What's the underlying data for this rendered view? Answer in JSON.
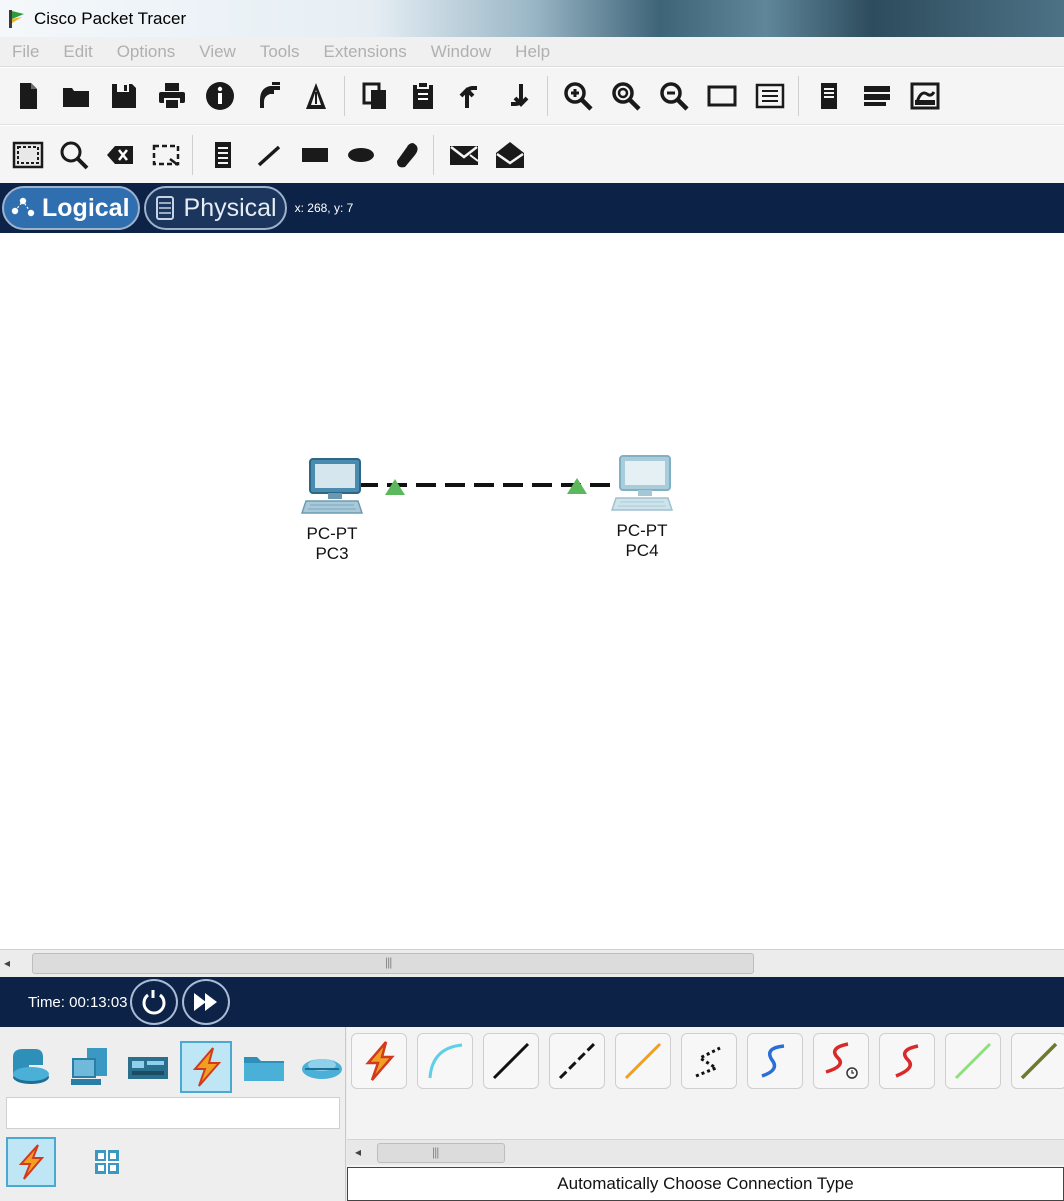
{
  "window": {
    "title": "Cisco Packet Tracer"
  },
  "menu": [
    "File",
    "Edit",
    "Options",
    "View",
    "Tools",
    "Extensions",
    "Window",
    "Help"
  ],
  "toolbar_main": [
    "new-file-icon",
    "open-folder-icon",
    "save-icon",
    "print-icon",
    "info-icon",
    "activity-wizard-icon",
    "pdu-icon",
    "separator",
    "copy-icon",
    "paste-icon",
    "undo-icon",
    "redo-icon",
    "separator",
    "zoom-in-icon",
    "zoom-reset-icon",
    "zoom-out-icon",
    "drawing-palette-icon",
    "custom-devices-icon",
    "separator",
    "viewport-icon",
    "cluster-icon",
    "screenshot-icon"
  ],
  "toolbar_tools": [
    "select-icon",
    "inspect-icon",
    "delete-icon",
    "resize-shape-icon",
    "separator",
    "place-note-icon",
    "draw-line-icon",
    "draw-rectangle-icon",
    "draw-ellipse-icon",
    "freeform-icon",
    "separator",
    "add-simple-pdu-icon",
    "add-complex-pdu-icon"
  ],
  "workspace": {
    "tabs": [
      {
        "label": "Logical",
        "active": true
      },
      {
        "label": "Physical",
        "active": false
      }
    ],
    "coordinates": "x: 268, y: 7"
  },
  "devices": [
    {
      "model": "PC-PT",
      "name": "PC3"
    },
    {
      "model": "PC-PT",
      "name": "PC4"
    }
  ],
  "link": {
    "style": "dashed",
    "port_status_color": "#5cb85c",
    "cable_color": "#111111"
  },
  "time": {
    "label": "Time: 00:13:03",
    "buttons": [
      "power-cycle-icon",
      "fast-forward-icon"
    ]
  },
  "device_categories": [
    "network-devices-icon",
    "end-devices-icon",
    "components-icon",
    "connections-icon",
    "miscellaneous-icon",
    "multiuser-icon"
  ],
  "selected_category": "connections-icon",
  "subcategories": [
    "connections-icon",
    "grid-icon"
  ],
  "connections": [
    "automatic-connection-icon",
    "console-cable-icon",
    "copper-straight-through-icon",
    "copper-cross-over-icon",
    "fiber-icon",
    "phone-cable-icon",
    "coaxial-icon",
    "serial-dce-icon",
    "serial-dte-icon",
    "octal-cable-icon",
    "iot-custom-cable-icon"
  ],
  "connection_status": "Automatically Choose Connection Type",
  "colors": {
    "navy_bar": "#0c2347",
    "logical_tab": "#2f6fb0",
    "selection_blue": "#bfe6f5"
  }
}
